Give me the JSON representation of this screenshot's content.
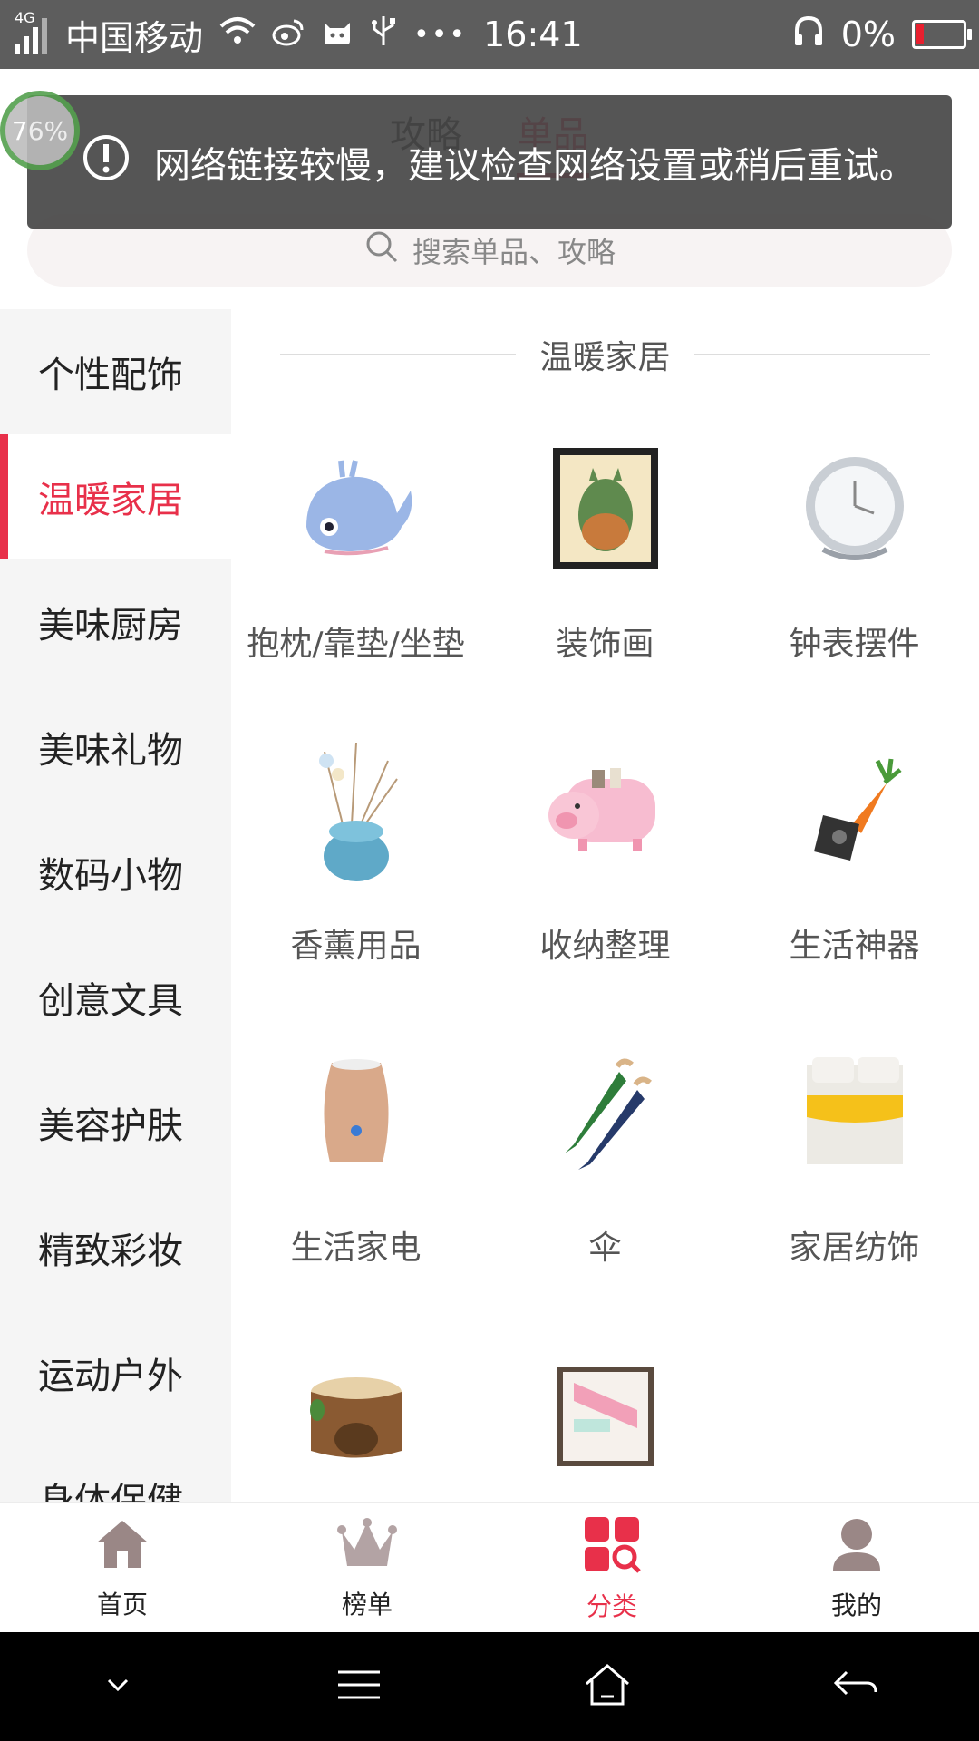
{
  "status_bar": {
    "network": "4G",
    "carrier": "中国移动",
    "time": "16:41",
    "battery": "0%"
  },
  "floating_badge": "76%",
  "tabs": [
    {
      "label": "攻略",
      "active": false
    },
    {
      "label": "单品",
      "active": true
    }
  ],
  "toast": {
    "message": "网络链接较慢，建议检查网络设置或稍后重试。"
  },
  "search": {
    "placeholder": "搜索单品、攻略"
  },
  "sidebar": {
    "items": [
      {
        "label": "个性配饰",
        "active": false
      },
      {
        "label": "温暖家居",
        "active": true
      },
      {
        "label": "美味厨房",
        "active": false
      },
      {
        "label": "美味礼物",
        "active": false
      },
      {
        "label": "数码小物",
        "active": false
      },
      {
        "label": "创意文具",
        "active": false
      },
      {
        "label": "美容护肤",
        "active": false
      },
      {
        "label": "精致彩妆",
        "active": false
      },
      {
        "label": "运动户外",
        "active": false
      },
      {
        "label": "身体保健",
        "active": false
      }
    ]
  },
  "section": {
    "title": "温暖家居",
    "categories": [
      {
        "label": "抱枕/靠垫/坐垫",
        "icon": "whale-pillow"
      },
      {
        "label": "装饰画",
        "icon": "framed-painting"
      },
      {
        "label": "钟表摆件",
        "icon": "desk-clock"
      },
      {
        "label": "香薰用品",
        "icon": "aroma-diffuser"
      },
      {
        "label": "收纳整理",
        "icon": "pig-organizer"
      },
      {
        "label": "生活神器",
        "icon": "carrot-sharpener"
      },
      {
        "label": "生活家电",
        "icon": "humidifier"
      },
      {
        "label": "伞",
        "icon": "umbrellas"
      },
      {
        "label": "家居纺饰",
        "icon": "bedding"
      },
      {
        "label": "",
        "icon": "pet-house-stump"
      },
      {
        "label": "",
        "icon": "boxed-blanket"
      }
    ]
  },
  "bottom_nav": [
    {
      "label": "首页",
      "icon": "home-icon",
      "active": false
    },
    {
      "label": "榜单",
      "icon": "crown-icon",
      "active": false
    },
    {
      "label": "分类",
      "icon": "category-icon",
      "active": true
    },
    {
      "label": "我的",
      "icon": "profile-icon",
      "active": false
    }
  ],
  "colors": {
    "accent": "#e8304a",
    "statusbar": "#5d5d5d",
    "sidebar_bg": "#f5f5f5"
  }
}
